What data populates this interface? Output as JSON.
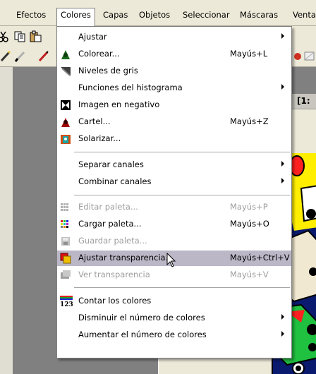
{
  "menubar": {
    "items": [
      {
        "label": "Efectos"
      },
      {
        "label": "Colores"
      },
      {
        "label": "Capas"
      },
      {
        "label": "Objetos"
      },
      {
        "label": "Seleccionar"
      },
      {
        "label": "Máscaras"
      },
      {
        "label": "Venta"
      }
    ]
  },
  "document": {
    "title": "[1:"
  },
  "menu": {
    "items": [
      {
        "label": "Ajustar",
        "shortcut": "",
        "submenu": true,
        "disabled": false,
        "icon": "none"
      },
      {
        "label": "Colorear...",
        "shortcut": "Mayús+L",
        "submenu": false,
        "disabled": false,
        "icon": "colorize-icon"
      },
      {
        "label": "Niveles de gris",
        "shortcut": "",
        "submenu": false,
        "disabled": false,
        "icon": "grayscale-icon"
      },
      {
        "label": "Funciones del histograma",
        "shortcut": "",
        "submenu": true,
        "disabled": false,
        "icon": "none"
      },
      {
        "label": "Imagen en negativo",
        "shortcut": "",
        "submenu": false,
        "disabled": false,
        "icon": "negative-icon"
      },
      {
        "label": "Cartel...",
        "shortcut": "Mayús+Z",
        "submenu": false,
        "disabled": false,
        "icon": "posterize-icon"
      },
      {
        "label": "Solarizar...",
        "shortcut": "",
        "submenu": false,
        "disabled": false,
        "icon": "solarize-icon"
      },
      {
        "label": "Separar canales",
        "shortcut": "",
        "submenu": true,
        "disabled": false,
        "icon": "none"
      },
      {
        "label": "Combinar canales",
        "shortcut": "",
        "submenu": true,
        "disabled": false,
        "icon": "none"
      },
      {
        "label": "Editar paleta...",
        "shortcut": "Mayús+P",
        "submenu": false,
        "disabled": true,
        "icon": "edit-palette-icon"
      },
      {
        "label": "Cargar paleta...",
        "shortcut": "Mayús+O",
        "submenu": false,
        "disabled": false,
        "icon": "load-palette-icon"
      },
      {
        "label": "Guardar paleta...",
        "shortcut": "",
        "submenu": false,
        "disabled": true,
        "icon": "save-palette-icon"
      },
      {
        "label": "Ajustar transparencia...",
        "shortcut": "Mayús+Ctrl+V",
        "submenu": false,
        "disabled": false,
        "icon": "transparency-icon",
        "highlighted": true
      },
      {
        "label": "Ver transparencia",
        "shortcut": "Mayús+V",
        "submenu": false,
        "disabled": true,
        "icon": "view-transparency-icon"
      },
      {
        "label": "Contar los colores",
        "shortcut": "",
        "submenu": false,
        "disabled": false,
        "icon": "count-colors-icon"
      },
      {
        "label": "Disminuir el número de colores",
        "shortcut": "",
        "submenu": true,
        "disabled": false,
        "icon": "none"
      },
      {
        "label": "Aumentar el número de colores",
        "shortcut": "",
        "submenu": true,
        "disabled": false,
        "icon": "none"
      }
    ]
  },
  "icons": {
    "count_colors_number": "123"
  },
  "colors": {
    "highlight": "#bbb7c7",
    "disabled_text": "#9d9d9d",
    "canvas": "#0a1a6e"
  }
}
